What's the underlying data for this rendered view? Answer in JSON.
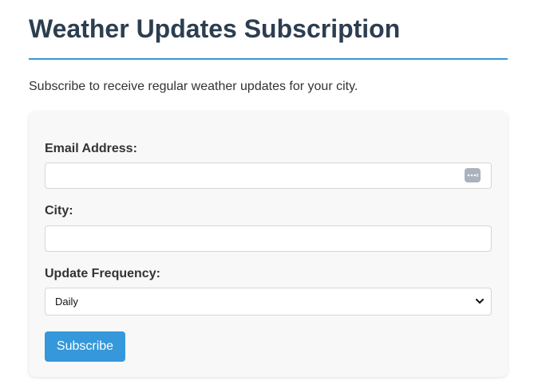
{
  "page": {
    "title": "Weather Updates Subscription",
    "intro": "Subscribe to receive regular weather updates for your city."
  },
  "form": {
    "email": {
      "label": "Email Address:",
      "value": "",
      "autofill_icon": "password-manager-icon"
    },
    "city": {
      "label": "City:",
      "value": ""
    },
    "frequency": {
      "label": "Update Frequency:",
      "selected": "Daily",
      "icon": "chevron-down-icon"
    },
    "submit_label": "Subscribe"
  },
  "colors": {
    "heading": "#2c3e50",
    "accent": "#3498db",
    "card_background": "#f8f8f8",
    "text": "#333333"
  }
}
